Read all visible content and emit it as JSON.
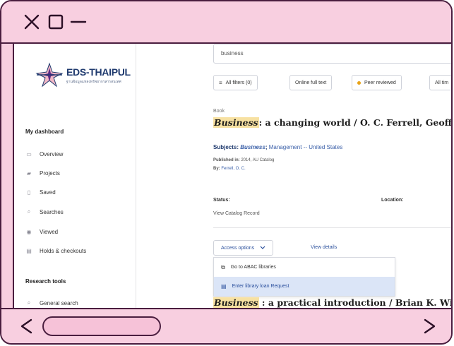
{
  "window": {
    "close_icon": "close-icon",
    "maximize_icon": "maximize-icon",
    "minimize_icon": "minimize-icon",
    "back_icon": "chevron-left-icon",
    "forward_icon": "chevron-right-icon"
  },
  "colors": {
    "frame": "#f8cfe0",
    "frame_border": "#4a1e3f",
    "brand_blue": "#1f3a6e",
    "link_blue": "#3a5fa8",
    "highlight": "#f7e1a2",
    "peer_dot": "#e8a317",
    "menu_selected": "#dbe5f7"
  },
  "logo": {
    "name": "EDS-THAIPUL",
    "subtitle": "ฐานข้อมูลแหล่งทรัพยากรสารสนเทศ"
  },
  "sidebar": {
    "dashboard_heading": "My dashboard",
    "dashboard_items": [
      {
        "label": "Overview",
        "icon": "overview-icon"
      },
      {
        "label": "Projects",
        "icon": "projects-icon"
      },
      {
        "label": "Saved",
        "icon": "saved-icon"
      },
      {
        "label": "Searches",
        "icon": "searches-icon"
      },
      {
        "label": "Viewed",
        "icon": "viewed-icon"
      },
      {
        "label": "Holds & checkouts",
        "icon": "holds-icon"
      }
    ],
    "tools_heading": "Research tools",
    "tools_items": [
      {
        "label": "General search",
        "icon": "search-icon"
      }
    ]
  },
  "search": {
    "value": "business"
  },
  "filters": [
    {
      "label": "All filters (0)",
      "icon": "filter-icon"
    },
    {
      "label": "Online full text"
    },
    {
      "label": "Peer reviewed"
    },
    {
      "label": "All tim"
    }
  ],
  "result1": {
    "type": "Book",
    "title_highlight": "Business",
    "title_rest": ": a changing world / O. C. Ferrell, Geoffre",
    "subjects_label": "Subjects:",
    "subject_highlight": "Business",
    "subject_link": "Management -- United States",
    "published_label": "Published in:",
    "published_value": "2014, AU Catalog",
    "by_label": "By:",
    "by_value": "Ferrell, O. C.",
    "status_label": "Status:",
    "location_label": "Location:",
    "record_link": "View Catalog Record",
    "access_label": "Access options",
    "details_label": "View details",
    "menu": [
      {
        "label": "Go to ABAC libraries",
        "icon": "external-link-icon"
      },
      {
        "label": "Enter library loan Request",
        "icon": "form-icon"
      }
    ]
  },
  "result2": {
    "title_highlight": "Business",
    "title_rest": " : a practical introduction / Brian K. Willi"
  }
}
